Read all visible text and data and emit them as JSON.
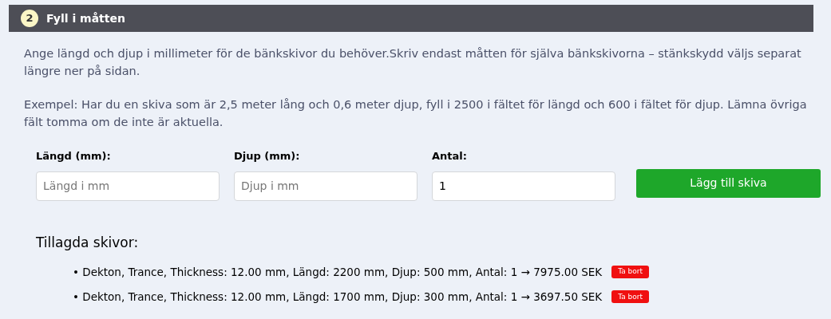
{
  "section": {
    "number": "2",
    "title": "Fyll i måtten"
  },
  "paragraphs": [
    "Ange längd och djup i millimeter för de bänkskivor du behöver.Skriv endast måtten för själva bänkskivorna – stänkskydd väljs separat längre ner på sidan.",
    "Exempel: Har du en skiva som är 2,5 meter lång och 0,6 meter djup, fyll i 2500 i fältet för längd och 600 i fältet för djup. Lämna övriga fält tomma om de inte är aktuella."
  ],
  "fields": [
    {
      "label": "Längd (mm):",
      "placeholder": "Längd i mm"
    },
    {
      "label": "Djup (mm):",
      "placeholder": "Djup i mm"
    },
    {
      "label": "Antal:",
      "value": "1"
    }
  ],
  "add_button": "Lägg till skiva",
  "added": {
    "heading": "Tillagda skivor:",
    "items": [
      {
        "bullet": "•",
        "text": "Dekton, Trance, Thickness: 12.00 mm, Längd: 2200 mm, Djup: 500 mm, Antal: 1 → 7975.00 SEK",
        "remove": "Ta bort"
      },
      {
        "bullet": "•",
        "text": "Dekton, Trance, Thickness: 12.00 mm, Längd: 1700 mm, Djup: 300 mm, Antal: 1 → 3697.50 SEK",
        "remove": "Ta bort"
      }
    ]
  }
}
